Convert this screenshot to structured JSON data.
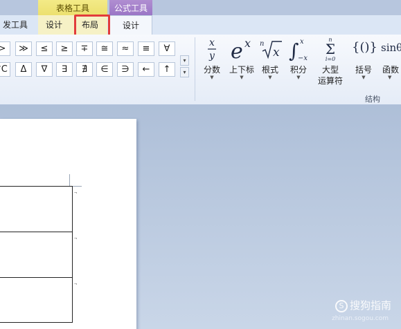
{
  "context_tabs": {
    "table_tools": "表格工具",
    "formula_tools": "公式工具"
  },
  "tabs": {
    "developer": "发工具",
    "table_design": "设计",
    "table_layout": "布局",
    "formula_design": "设计"
  },
  "symbols_row1": [
    ">",
    "≫",
    "≤",
    "≥",
    "∓",
    "≅",
    "≈",
    "≡",
    "∀"
  ],
  "symbols_row2": [
    "°C",
    "Δ",
    "∇",
    "∃",
    "∄",
    "∈",
    "∋",
    "←",
    "↑"
  ],
  "structures": [
    {
      "key": "fraction",
      "glyph": "x/y",
      "label": "分数",
      "label2": ""
    },
    {
      "key": "script",
      "glyph": "eˣ",
      "label": "上下标",
      "label2": ""
    },
    {
      "key": "radical",
      "glyph": "ⁿ√x",
      "label": "根式",
      "label2": ""
    },
    {
      "key": "integral",
      "glyph": "∫",
      "label": "积分",
      "label2": ""
    },
    {
      "key": "large_operator",
      "glyph": "Σ",
      "label": "大型",
      "label2": "运算符"
    },
    {
      "key": "bracket",
      "glyph": "{()}",
      "label": "括号",
      "label2": ""
    },
    {
      "key": "function",
      "glyph": "sinθ",
      "label": "函数",
      "label2": ""
    }
  ],
  "group_label": "结构",
  "watermark": {
    "logo": "S",
    "text": "搜狗指南",
    "site": "zhinan.sogou.com"
  },
  "colors": {
    "highlight": "#e23b3b",
    "table_tools": "#ece06f",
    "formula_tools": "#9b76c6"
  }
}
